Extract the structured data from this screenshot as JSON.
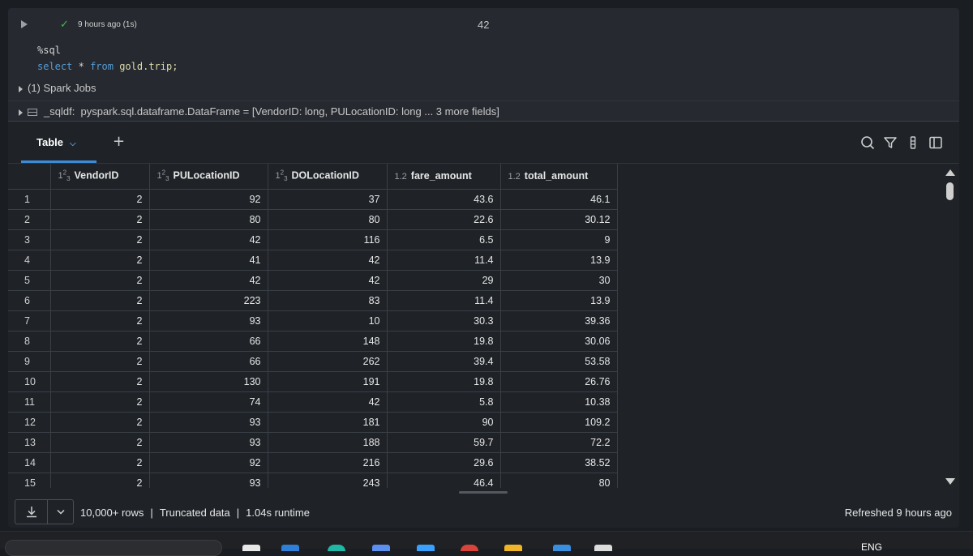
{
  "cell": {
    "status_time": "9 hours ago (1s)",
    "cell_number": "42",
    "code": {
      "magic": "%sql",
      "kw_select": "select",
      "star": "*",
      "kw_from": "from",
      "table": "gold.trip;"
    },
    "spark_jobs": "(1) Spark Jobs",
    "df_name": "_sqldf:",
    "df_type": "pyspark.sql.dataframe.DataFrame = [VendorID: long, PULocationID: long ... 3 more fields]"
  },
  "tabs": {
    "table_label": "Table",
    "add_label": "+"
  },
  "grid": {
    "columns": [
      {
        "type_icon": "123",
        "name": "VendorID"
      },
      {
        "type_icon": "123",
        "name": "PULocationID"
      },
      {
        "type_icon": "123",
        "name": "DOLocationID"
      },
      {
        "type_icon": "1.2",
        "name": "fare_amount"
      },
      {
        "type_icon": "1.2",
        "name": "total_amount"
      }
    ],
    "rows": [
      [
        "1",
        "2",
        "92",
        "37",
        "43.6",
        "46.1"
      ],
      [
        "2",
        "2",
        "80",
        "80",
        "22.6",
        "30.12"
      ],
      [
        "3",
        "2",
        "42",
        "116",
        "6.5",
        "9"
      ],
      [
        "4",
        "2",
        "41",
        "42",
        "11.4",
        "13.9"
      ],
      [
        "5",
        "2",
        "42",
        "42",
        "29",
        "30"
      ],
      [
        "6",
        "2",
        "223",
        "83",
        "11.4",
        "13.9"
      ],
      [
        "7",
        "2",
        "93",
        "10",
        "30.3",
        "39.36"
      ],
      [
        "8",
        "2",
        "66",
        "148",
        "19.8",
        "30.06"
      ],
      [
        "9",
        "2",
        "66",
        "262",
        "39.4",
        "53.58"
      ],
      [
        "10",
        "2",
        "130",
        "191",
        "19.8",
        "26.76"
      ],
      [
        "11",
        "2",
        "74",
        "42",
        "5.8",
        "10.38"
      ],
      [
        "12",
        "2",
        "93",
        "181",
        "90",
        "109.2"
      ],
      [
        "13",
        "2",
        "93",
        "188",
        "59.7",
        "72.2"
      ],
      [
        "14",
        "2",
        "92",
        "216",
        "29.6",
        "38.52"
      ],
      [
        "15",
        "2",
        "93",
        "243",
        "46.4",
        "80"
      ]
    ]
  },
  "footer": {
    "rows_info": "10,000+ rows",
    "sep1": "|",
    "truncated": "Truncated data",
    "sep2": "|",
    "runtime": "1.04s runtime",
    "refreshed": "Refreshed 9 hours ago"
  },
  "taskbar": {
    "language": "ENG"
  },
  "colors": {
    "accent": "#3d8bd6",
    "success": "#3fb950",
    "background": "#1f2328"
  }
}
